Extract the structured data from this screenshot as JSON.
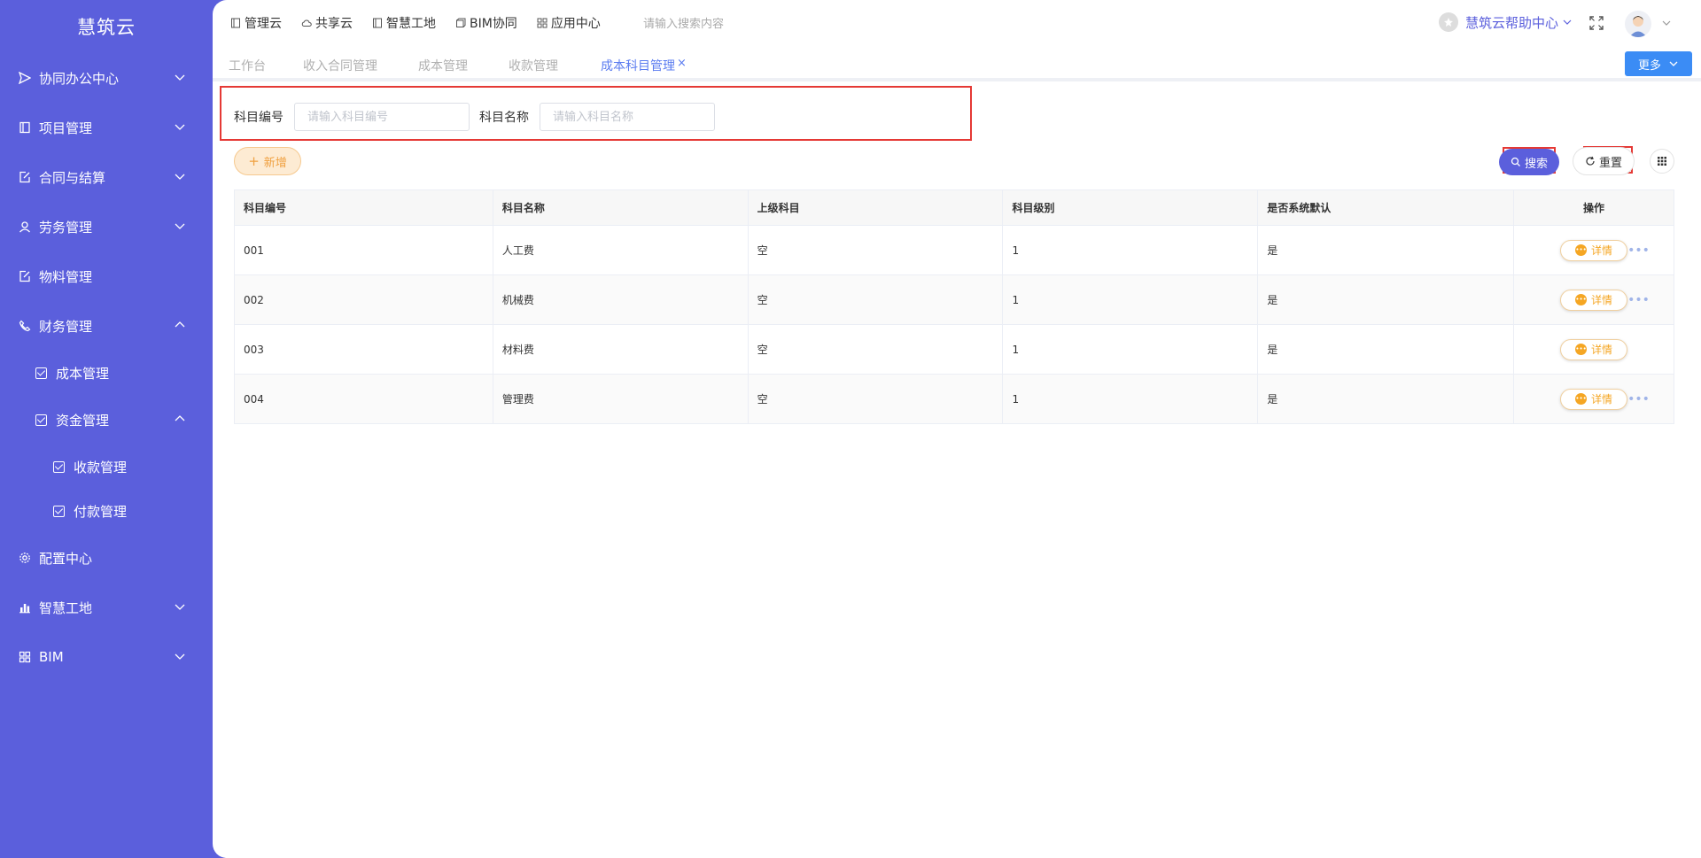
{
  "sidebar": {
    "brand": "慧筑云",
    "items": [
      {
        "label": "协同办公中心",
        "icon": "send-icon"
      },
      {
        "label": "项目管理",
        "icon": "book-icon"
      },
      {
        "label": "合同与结算",
        "icon": "edit-doc-icon"
      },
      {
        "label": "劳务管理",
        "icon": "worker-icon"
      },
      {
        "label": "物料管理",
        "icon": "edit-doc-icon"
      },
      {
        "label": "财务管理",
        "icon": "phone-icon"
      },
      {
        "label": "成本管理",
        "icon": "checkbox-icon"
      },
      {
        "label": "资金管理",
        "icon": "checkbox-icon"
      },
      {
        "label": "收款管理",
        "icon": "checkbox-icon"
      },
      {
        "label": "付款管理",
        "icon": "checkbox-icon"
      },
      {
        "label": "配置中心",
        "icon": "gear-icon"
      },
      {
        "label": "智慧工地",
        "icon": "bar-chart-icon"
      },
      {
        "label": "BIM",
        "icon": "grid-icon"
      }
    ]
  },
  "topbar": {
    "links": [
      "管理云",
      "共享云",
      "智慧工地",
      "BIM协同",
      "应用中心"
    ],
    "search_placeholder": "请输入搜索内容",
    "help_label": "慧筑云帮助中心"
  },
  "tabs": {
    "items": [
      "工作台",
      "收入合同管理",
      "成本管理",
      "收款管理",
      "成本科目管理"
    ],
    "close": "×",
    "more_label": "更多"
  },
  "filter": {
    "code_label": "科目编号",
    "code_placeholder": "请输入科目编号",
    "name_label": "科目名称",
    "name_placeholder": "请输入科目名称"
  },
  "actions": {
    "add_label": "新增",
    "search_label": "搜索",
    "reset_label": "重置"
  },
  "table": {
    "headers": [
      "科目编号",
      "科目名称",
      "上级科目",
      "科目级别",
      "是否系统默认",
      "操作"
    ],
    "rows": [
      [
        "001",
        "人工费",
        "空",
        "1",
        "是"
      ],
      [
        "002",
        "机械费",
        "空",
        "1",
        "是"
      ],
      [
        "003",
        "材料费",
        "空",
        "1",
        "是"
      ],
      [
        "004",
        "管理费",
        "空",
        "1",
        "是"
      ]
    ],
    "detail_label": "详情",
    "more_dots": "•••"
  },
  "colors": {
    "sidebar_bg": "#5b5fdc",
    "accent": "#5b5fdc",
    "tab_active": "#5b7cf0",
    "more_button": "#3b8cf5",
    "detail_orange": "#f5a623",
    "highlight_red": "#e53935"
  }
}
